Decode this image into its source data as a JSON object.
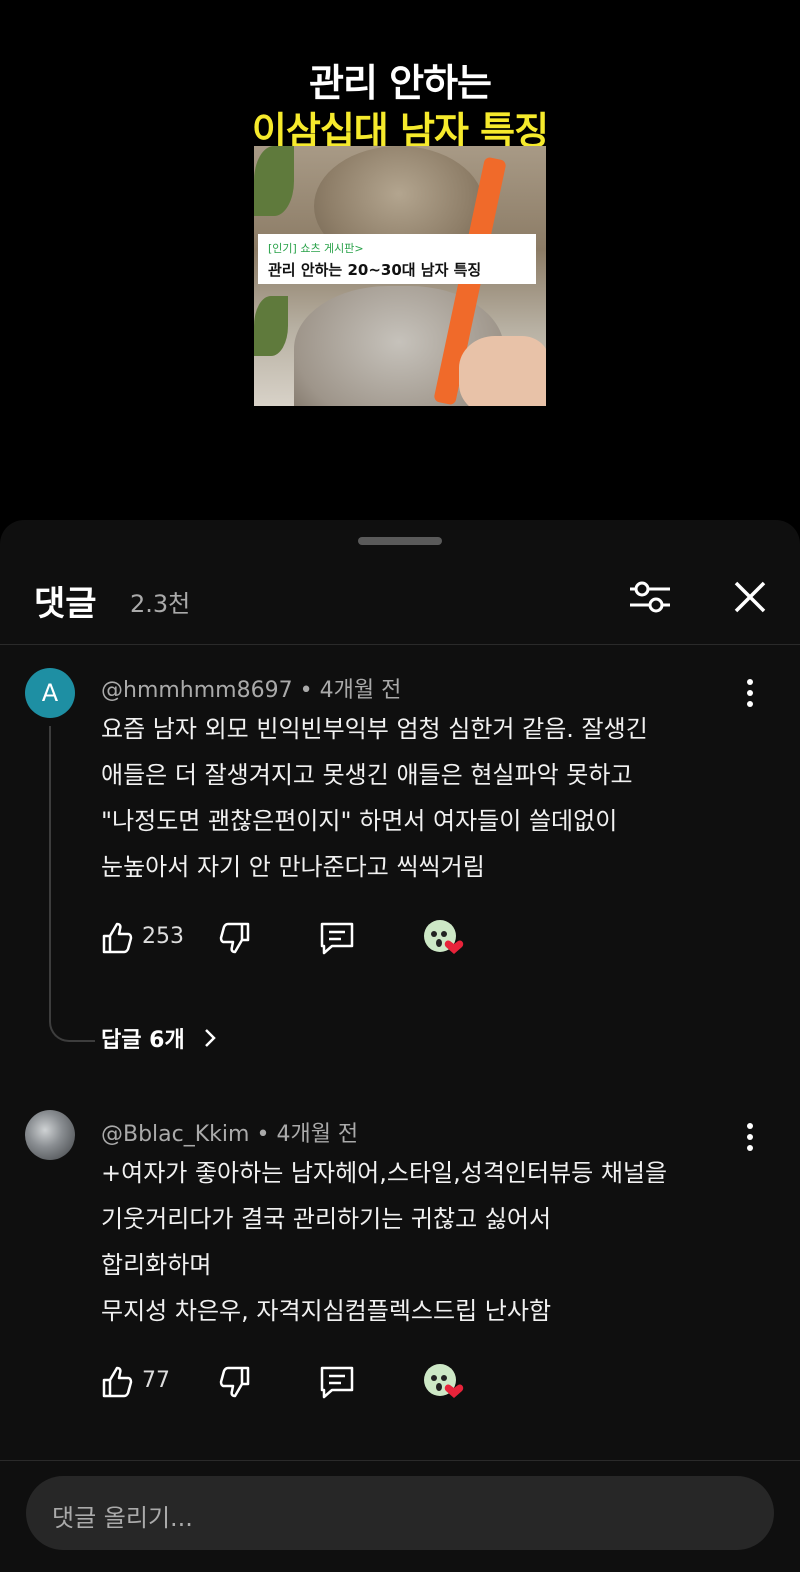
{
  "video": {
    "title_line1": "관리 안하는",
    "title_line2": "이삼십대 남자 특징",
    "card_tag": "[인기] 쇼츠 게시판>",
    "card_title": "관리 안하는 20~30대 남자 특징"
  },
  "comments_panel": {
    "title": "댓글",
    "count": "2.3천"
  },
  "comments": [
    {
      "avatar_letter": "A",
      "author": "@hmmhmm8697",
      "time": "4개월 전",
      "text": "요즘 남자 외모 빈익빈부익부 엄청 심한거 같음. 잘생긴\n애들은 더 잘생겨지고 못생긴 애들은 현실파악 못하고\n\"나정도면 괜찮은편이지\" 하면서 여자들이 쓸데없이\n눈높아서 자기 안 만나준다고 씩씩거림",
      "likes": "253",
      "replies_label": "답글 6개"
    },
    {
      "author": "@Bblac_Kkim",
      "time": "4개월 전",
      "text": "+여자가 좋아하는 남자헤어,스타일,성격인터뷰등 채널을\n기웃거리다가 결국 관리하기는 귀찮고 싫어서\n합리화하며\n무지성 차은우, 자격지심컴플렉스드립 난사함",
      "likes": "77"
    }
  ],
  "input": {
    "placeholder": "댓글 올리기..."
  },
  "colors": {
    "background": "#0f0f0f",
    "accent_yellow": "#f6ea2c",
    "avatar_teal": "#1e8fa3",
    "heart_red": "#e8233a"
  }
}
